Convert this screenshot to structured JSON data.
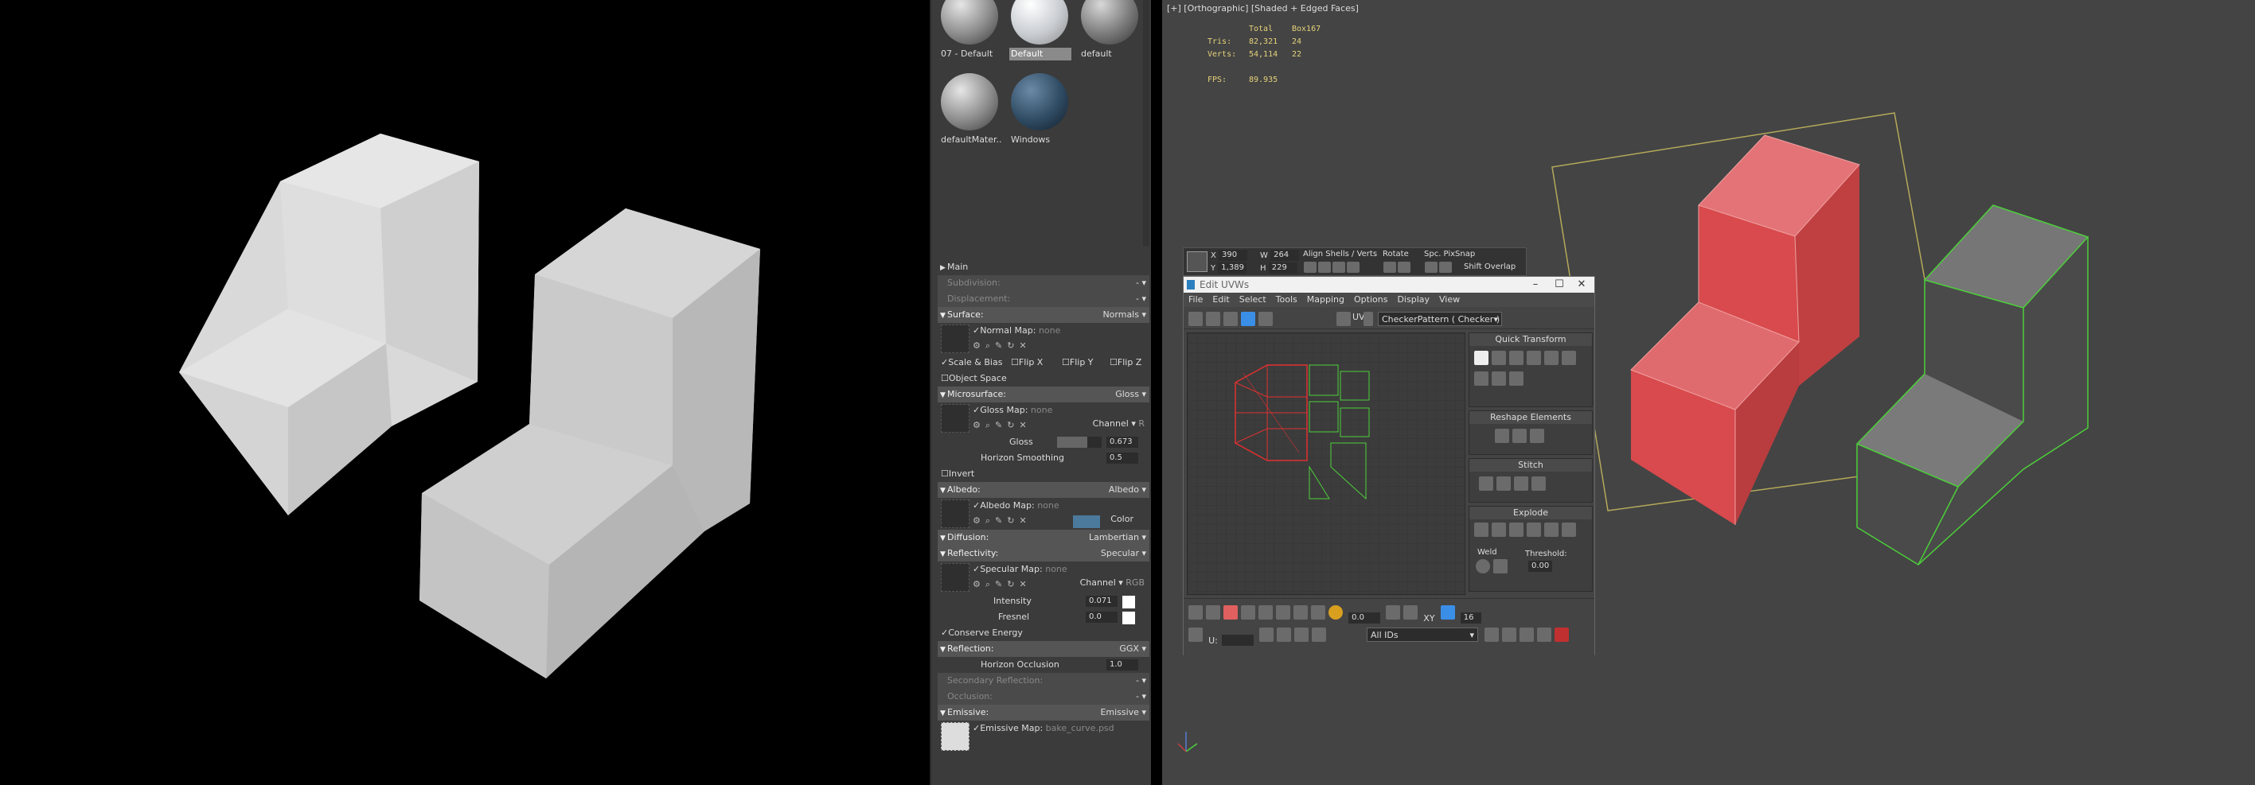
{
  "viewport": {
    "label": "[+] [Orthographic] [Shaded + Edged Faces]",
    "stats": {
      "header_total": "Total",
      "header_object": "Box167",
      "tris_label": "Tris:",
      "tris_total": "82,321",
      "tris_object": "24",
      "verts_label": "Verts:",
      "verts_total": "54,114",
      "verts_object": "22",
      "fps_label": "FPS:",
      "fps_value": "89.935"
    }
  },
  "materials": [
    {
      "name": "07 - Default",
      "color": "#8c8c8c"
    },
    {
      "name": "Default",
      "color": "#c9cdd2"
    },
    {
      "name": "default",
      "color": "#7a7a7a"
    },
    {
      "name": "defaultMater...",
      "color": "#8c8c8c"
    },
    {
      "name": "Windows",
      "color": "#2f4b63"
    }
  ],
  "props": {
    "main": "Main",
    "subdivision": "Subdivision:",
    "displacement": "Displacement:",
    "surface": "Surface:",
    "surface_mode": "Normals",
    "normal_map_label": "Normal Map:",
    "normal_map_value": "none",
    "scale_bias": "Scale & Bias",
    "flip_x": "Flip X",
    "flip_y": "Flip Y",
    "flip_z": "Flip Z",
    "object_space": "Object Space",
    "microsurface": "Microsurface:",
    "microsurface_mode": "Gloss",
    "gloss_map_label": "Gloss Map:",
    "gloss_map_value": "none",
    "channel_label": "Channel",
    "gloss_channel": "R",
    "gloss_label": "Gloss",
    "gloss_value": "0.673",
    "gloss_fraction": 0.673,
    "horizon_smoothing_label": "Horizon Smoothing",
    "horizon_smoothing_value": "0.5",
    "invert": "Invert",
    "albedo": "Albedo:",
    "albedo_mode": "Albedo",
    "albedo_map_label": "Albedo Map:",
    "albedo_map_value": "none",
    "albedo_color_label": "Color",
    "albedo_color": "#4b7a9c",
    "diffusion": "Diffusion:",
    "diffusion_mode": "Lambertian",
    "reflectivity": "Reflectivity:",
    "reflectivity_mode": "Specular",
    "specular_map_label": "Specular Map:",
    "specular_map_value": "none",
    "specular_channel": "RGB",
    "intensity_label": "Intensity",
    "intensity_value": "0.071",
    "fresnel_label": "Fresnel",
    "fresnel_value": "0.0",
    "conserve_energy": "Conserve Energy",
    "reflection": "Reflection:",
    "reflection_mode": "GGX",
    "horizon_occlusion_label": "Horizon Occlusion",
    "horizon_occlusion_value": "1.0",
    "secondary_reflection": "Secondary Reflection:",
    "occlusion": "Occlusion:",
    "emissive": "Emissive:",
    "emissive_mode": "Emissive",
    "emissive_map_label": "Emissive Map:",
    "emissive_map_value": "bake_curve.psd"
  },
  "uv_toolbar": {
    "x_label": "X",
    "x_value": "390",
    "y_label": "Y",
    "y_value": "1,389",
    "w_label": "W",
    "w_value": "264",
    "h_label": "H",
    "h_value": "229",
    "align_label": "Align Shells / Verts",
    "rotate_label": "Rotate",
    "spc_label": "Spc. PixSnap",
    "shift_overlap": "Shift Overlap"
  },
  "uv_editor": {
    "title": "Edit UVWs",
    "menu": [
      "File",
      "Edit",
      "Select",
      "Tools",
      "Mapping",
      "Options",
      "Display",
      "View"
    ],
    "uv_label": "UV",
    "checker": "CheckerPattern  ( Checker )",
    "quick_transform": "Quick Transform",
    "reshape_elements": "Reshape Elements",
    "stitch": "Stitch",
    "explode": "Explode",
    "weld": "Weld",
    "threshold_label": "Threshold:",
    "threshold_value": "0.00",
    "angle_value": "0.0",
    "spin_value": "16",
    "u_label": "U:",
    "xy_label": "XY",
    "ids_dropdown": "All IDs"
  }
}
